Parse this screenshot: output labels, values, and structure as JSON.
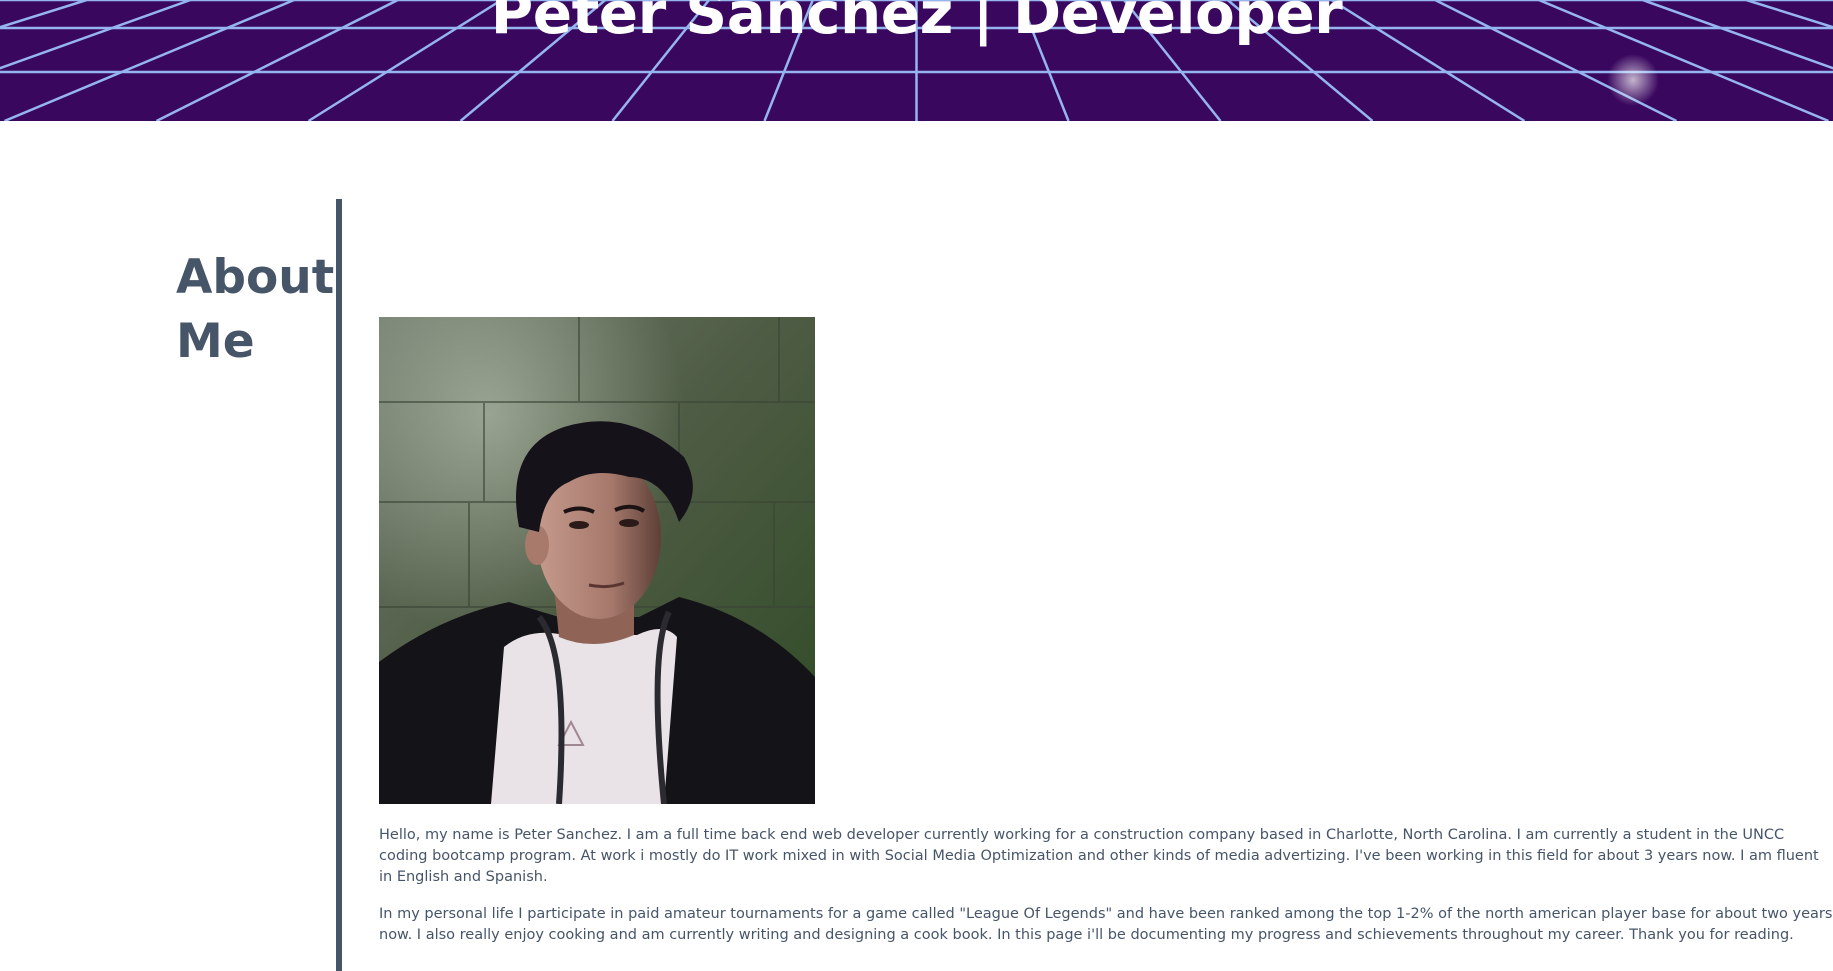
{
  "header": {
    "title": "Peter Sanchez | Developer",
    "background_color": "#3a075f",
    "grid_color": "#9fc8ff"
  },
  "about": {
    "heading": "About Me",
    "heading_color": "#475569",
    "portrait_icon": "person-portrait-photo",
    "paragraphs": [
      "Hello, my name is Peter Sanchez. I am a full time back end web developer currently working for a construction company based in Charlotte, North Carolina. I am currently a student in the UNCC coding bootcamp program. At work i mostly do IT work mixed in with Social Media Optimization and other kinds of media advertizing. I've been working in this field for about 3 years now. I am fluent in English and Spanish.",
      "In my personal life I participate in paid amateur tournaments for a game called \"League Of Legends\" and have been ranked among the top 1-2% of the north american player base for about two years now. I also really enjoy cooking and am currently writing and designing a cook book. In this page i'll be documenting my progress and schievements throughout my career. Thank you for reading."
    ]
  }
}
